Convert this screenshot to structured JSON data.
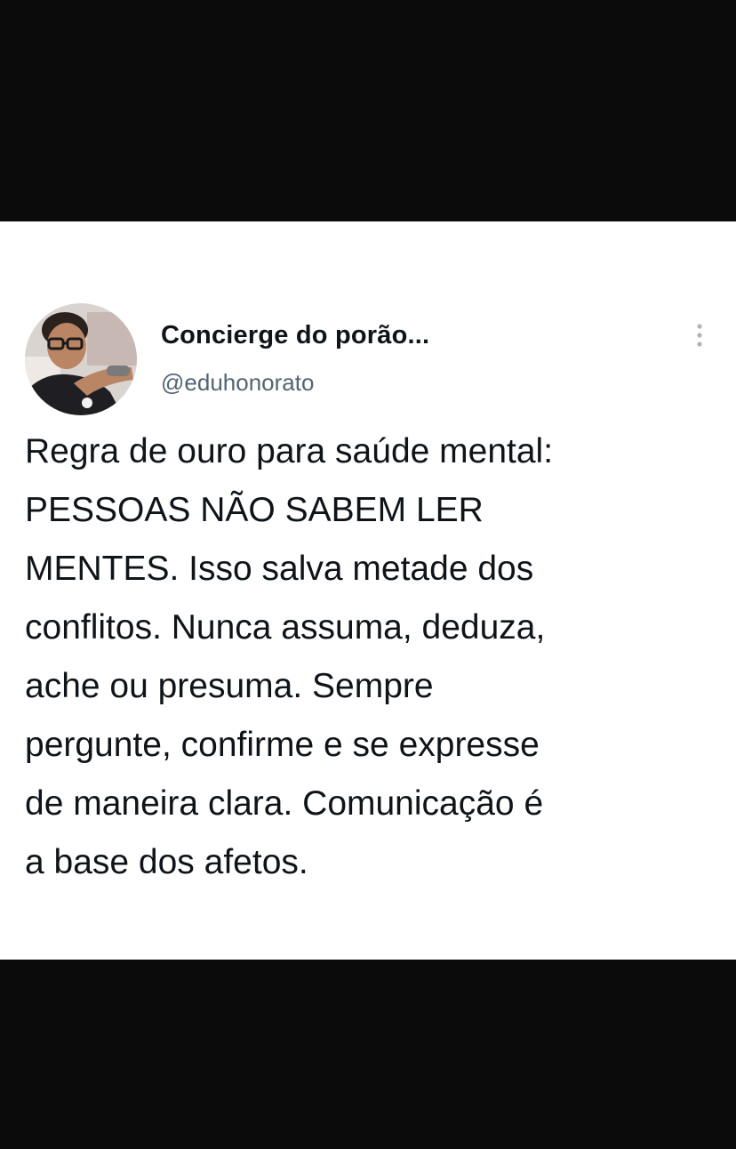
{
  "tweet": {
    "display_name": "Concierge do porão...",
    "handle": "@eduhonorato",
    "more_icon": "more-vertical-icon",
    "avatar_icon": "profile-photo",
    "text_lines": [
      "Regra de ouro para saúde mental:",
      "PESSOAS NÃO SABEM LER",
      "MENTES. Isso salva metade dos",
      "conflitos. Nunca assuma, deduza,",
      "ache ou presuma. Sempre",
      "pergunte, confirme e se expresse",
      "de maneira clara. Comunicação é",
      "a base dos afetos."
    ]
  },
  "colors": {
    "background_bars": "#0b0b0b",
    "card": "#ffffff",
    "text_primary": "#0f1419",
    "text_secondary": "#536471"
  }
}
